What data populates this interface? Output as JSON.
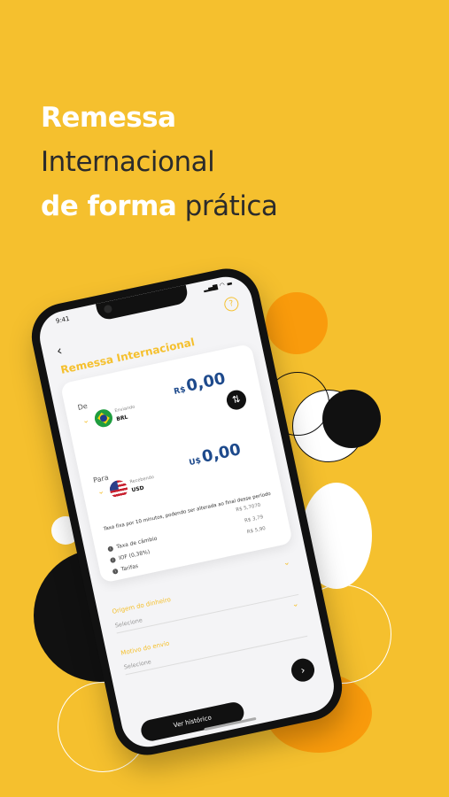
{
  "headline": {
    "line1": "Remessa",
    "line2": "Internacional",
    "line3_bold": "de forma",
    "line3_thin": "prática"
  },
  "colors": {
    "background": "#F5C02E",
    "accent_orange": "#F99B0C",
    "dark": "#111111",
    "amount_blue": "#1E4A8C"
  },
  "status": {
    "time": "9:41",
    "icons": "▂▄▆ ◠ ▬"
  },
  "app": {
    "back_icon": "‹",
    "help_icon": "?",
    "title": "Remessa Internacional",
    "from": {
      "label": "De",
      "sub": "Enviando",
      "currency": "BRL",
      "symbol": "R$",
      "amount": "0,00"
    },
    "swap_icon": "⇅",
    "to": {
      "label": "Para",
      "sub": "Recebendo",
      "currency": "USD",
      "symbol": "U$",
      "amount": "0,00"
    },
    "fee_note": "Taxa fixa por 10 minutos, podendo ser alterada ao final desse período",
    "fees": [
      {
        "label": "Taxa de câmbio",
        "value": "R$ 5,7070"
      },
      {
        "label": "IOF (0,38%)",
        "value": "R$ 3,79"
      },
      {
        "label": "Tarifas",
        "value": "R$ 5,90"
      }
    ],
    "origin_label": "Origem do dinheiro",
    "origin_value": "Selecione",
    "motive_label": "Motivo do envio",
    "motive_value": "Selecione",
    "history_button": "Ver histórico",
    "next_icon": "›"
  }
}
